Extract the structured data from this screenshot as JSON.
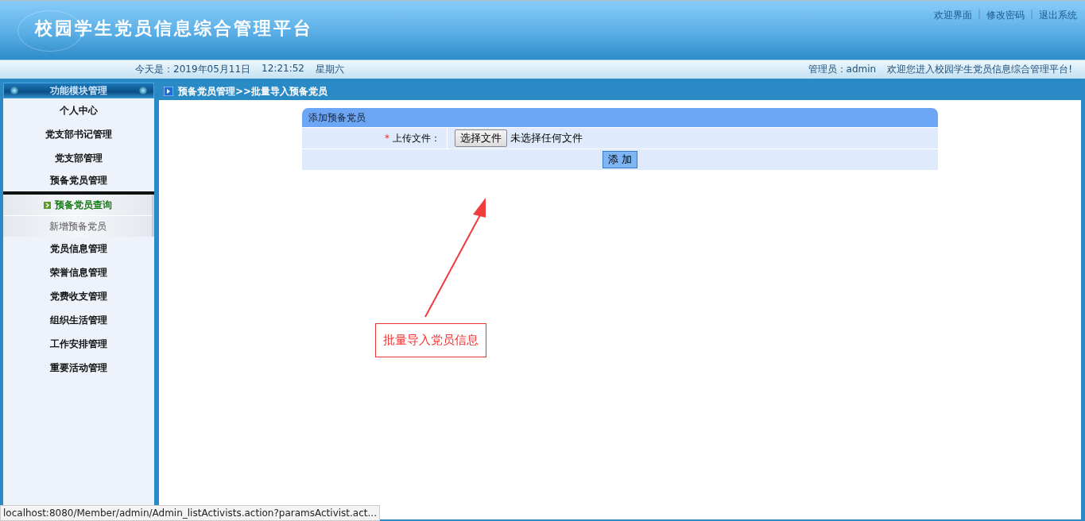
{
  "header": {
    "title": "校园学生党员信息综合管理平台",
    "links": [
      {
        "kind": "link",
        "text": "欢迎界面"
      },
      {
        "kind": "separator",
        "text": "|"
      },
      {
        "kind": "link",
        "text": "修改密码"
      },
      {
        "kind": "separator",
        "text": "|"
      },
      {
        "kind": "link",
        "text": "退出系统"
      }
    ]
  },
  "info_bar": {
    "date": "今天是：2019年05月11日",
    "time": "12:21:52",
    "weekday": "星期六",
    "admin": "管理员：admin",
    "welcome": "欢迎您进入校园学生党员信息综合管理平台!"
  },
  "sidebar": {
    "title": "功能模块管理",
    "items": [
      {
        "label": "个人中心",
        "expanded": false
      },
      {
        "label": "党支部书记管理",
        "expanded": false
      },
      {
        "label": "党支部管理",
        "expanded": false
      },
      {
        "label": "预备党员管理",
        "expanded": true,
        "children": [
          {
            "label": "预备党员查询",
            "selected": true
          },
          {
            "label": "新增预备党员",
            "selected": false
          }
        ]
      },
      {
        "label": "党员信息管理",
        "expanded": false
      },
      {
        "label": "荣誉信息管理",
        "expanded": false
      },
      {
        "label": "党费收支管理",
        "expanded": false
      },
      {
        "label": "组织生活管理",
        "expanded": false
      },
      {
        "label": "工作安排管理",
        "expanded": false
      },
      {
        "label": "重要活动管理",
        "expanded": false
      }
    ]
  },
  "breadcrumb": "预备党员管理>>批量导入预备党员",
  "form": {
    "title": "添加预备党员",
    "field": {
      "required": true,
      "required_mark": "*",
      "label": "上传文件：",
      "button": "选择文件",
      "value": "未选择任何文件"
    },
    "submit": "添 加"
  },
  "annotation": {
    "text": "批量导入党员信息"
  },
  "status_bar": {
    "url": "localhost:8080/Member/admin/Admin_listActivists.action?paramsActivist.act..."
  }
}
